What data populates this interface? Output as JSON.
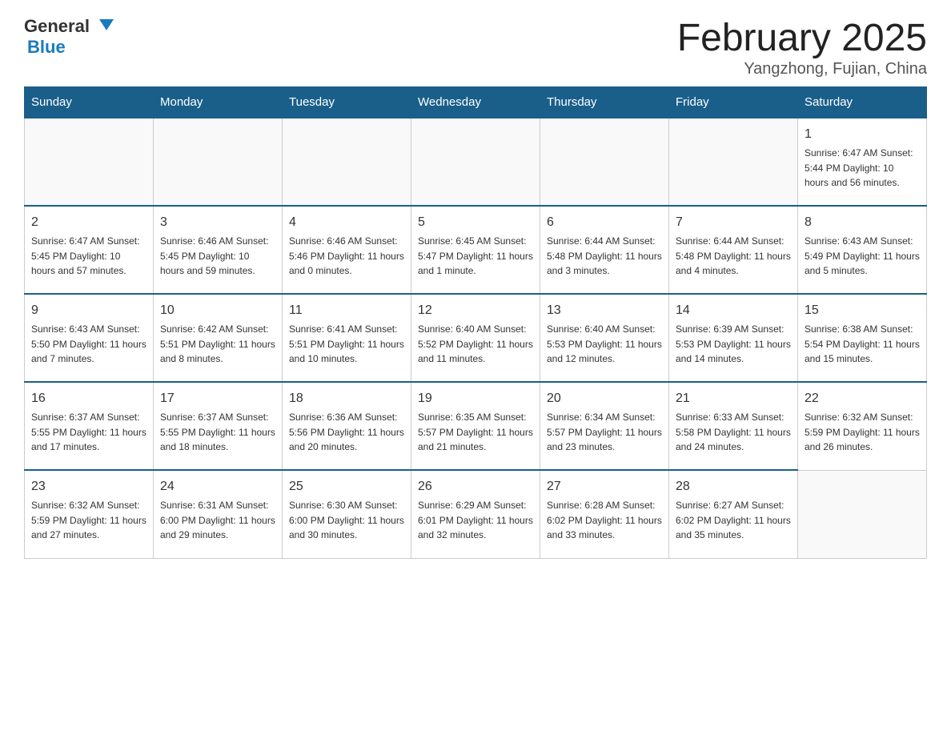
{
  "header": {
    "logo_general": "General",
    "logo_blue": "Blue",
    "month_title": "February 2025",
    "location": "Yangzhong, Fujian, China"
  },
  "weekdays": [
    "Sunday",
    "Monday",
    "Tuesday",
    "Wednesday",
    "Thursday",
    "Friday",
    "Saturday"
  ],
  "weeks": [
    [
      {
        "day": "",
        "info": ""
      },
      {
        "day": "",
        "info": ""
      },
      {
        "day": "",
        "info": ""
      },
      {
        "day": "",
        "info": ""
      },
      {
        "day": "",
        "info": ""
      },
      {
        "day": "",
        "info": ""
      },
      {
        "day": "1",
        "info": "Sunrise: 6:47 AM\nSunset: 5:44 PM\nDaylight: 10 hours and 56 minutes."
      }
    ],
    [
      {
        "day": "2",
        "info": "Sunrise: 6:47 AM\nSunset: 5:45 PM\nDaylight: 10 hours and 57 minutes."
      },
      {
        "day": "3",
        "info": "Sunrise: 6:46 AM\nSunset: 5:45 PM\nDaylight: 10 hours and 59 minutes."
      },
      {
        "day": "4",
        "info": "Sunrise: 6:46 AM\nSunset: 5:46 PM\nDaylight: 11 hours and 0 minutes."
      },
      {
        "day": "5",
        "info": "Sunrise: 6:45 AM\nSunset: 5:47 PM\nDaylight: 11 hours and 1 minute."
      },
      {
        "day": "6",
        "info": "Sunrise: 6:44 AM\nSunset: 5:48 PM\nDaylight: 11 hours and 3 minutes."
      },
      {
        "day": "7",
        "info": "Sunrise: 6:44 AM\nSunset: 5:48 PM\nDaylight: 11 hours and 4 minutes."
      },
      {
        "day": "8",
        "info": "Sunrise: 6:43 AM\nSunset: 5:49 PM\nDaylight: 11 hours and 5 minutes."
      }
    ],
    [
      {
        "day": "9",
        "info": "Sunrise: 6:43 AM\nSunset: 5:50 PM\nDaylight: 11 hours and 7 minutes."
      },
      {
        "day": "10",
        "info": "Sunrise: 6:42 AM\nSunset: 5:51 PM\nDaylight: 11 hours and 8 minutes."
      },
      {
        "day": "11",
        "info": "Sunrise: 6:41 AM\nSunset: 5:51 PM\nDaylight: 11 hours and 10 minutes."
      },
      {
        "day": "12",
        "info": "Sunrise: 6:40 AM\nSunset: 5:52 PM\nDaylight: 11 hours and 11 minutes."
      },
      {
        "day": "13",
        "info": "Sunrise: 6:40 AM\nSunset: 5:53 PM\nDaylight: 11 hours and 12 minutes."
      },
      {
        "day": "14",
        "info": "Sunrise: 6:39 AM\nSunset: 5:53 PM\nDaylight: 11 hours and 14 minutes."
      },
      {
        "day": "15",
        "info": "Sunrise: 6:38 AM\nSunset: 5:54 PM\nDaylight: 11 hours and 15 minutes."
      }
    ],
    [
      {
        "day": "16",
        "info": "Sunrise: 6:37 AM\nSunset: 5:55 PM\nDaylight: 11 hours and 17 minutes."
      },
      {
        "day": "17",
        "info": "Sunrise: 6:37 AM\nSunset: 5:55 PM\nDaylight: 11 hours and 18 minutes."
      },
      {
        "day": "18",
        "info": "Sunrise: 6:36 AM\nSunset: 5:56 PM\nDaylight: 11 hours and 20 minutes."
      },
      {
        "day": "19",
        "info": "Sunrise: 6:35 AM\nSunset: 5:57 PM\nDaylight: 11 hours and 21 minutes."
      },
      {
        "day": "20",
        "info": "Sunrise: 6:34 AM\nSunset: 5:57 PM\nDaylight: 11 hours and 23 minutes."
      },
      {
        "day": "21",
        "info": "Sunrise: 6:33 AM\nSunset: 5:58 PM\nDaylight: 11 hours and 24 minutes."
      },
      {
        "day": "22",
        "info": "Sunrise: 6:32 AM\nSunset: 5:59 PM\nDaylight: 11 hours and 26 minutes."
      }
    ],
    [
      {
        "day": "23",
        "info": "Sunrise: 6:32 AM\nSunset: 5:59 PM\nDaylight: 11 hours and 27 minutes."
      },
      {
        "day": "24",
        "info": "Sunrise: 6:31 AM\nSunset: 6:00 PM\nDaylight: 11 hours and 29 minutes."
      },
      {
        "day": "25",
        "info": "Sunrise: 6:30 AM\nSunset: 6:00 PM\nDaylight: 11 hours and 30 minutes."
      },
      {
        "day": "26",
        "info": "Sunrise: 6:29 AM\nSunset: 6:01 PM\nDaylight: 11 hours and 32 minutes."
      },
      {
        "day": "27",
        "info": "Sunrise: 6:28 AM\nSunset: 6:02 PM\nDaylight: 11 hours and 33 minutes."
      },
      {
        "day": "28",
        "info": "Sunrise: 6:27 AM\nSunset: 6:02 PM\nDaylight: 11 hours and 35 minutes."
      },
      {
        "day": "",
        "info": ""
      }
    ]
  ]
}
